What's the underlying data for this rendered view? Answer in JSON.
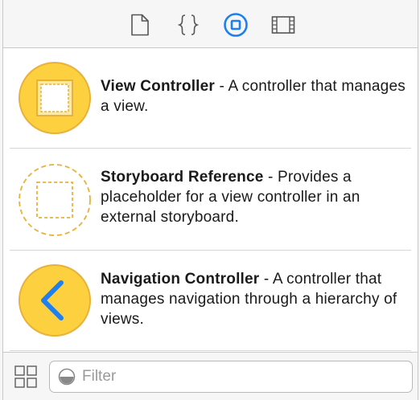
{
  "toolbar": {
    "tabs": [
      {
        "icon": "file-template-icon",
        "selected": false
      },
      {
        "icon": "code-snippet-icon",
        "selected": false
      },
      {
        "icon": "object-library-icon",
        "selected": true
      },
      {
        "icon": "media-library-icon",
        "selected": false
      }
    ],
    "accent_color": "#1e7ff0"
  },
  "library": {
    "items": [
      {
        "title": "View Controller",
        "separator": " - ",
        "description": "A controller that manages a view.",
        "icon": "view-controller-icon"
      },
      {
        "title": "Storyboard Reference",
        "separator": " - ",
        "description": "Provides a placeholder for a view controller in an external storyboard.",
        "icon": "storyboard-reference-icon"
      },
      {
        "title": "Navigation Controller",
        "separator": " - ",
        "description": "A controller that manages navigation through a hierarchy of views.",
        "icon": "navigation-controller-icon"
      }
    ],
    "icon_color": "#fcd03f",
    "icon_stroke": "#e8b23a"
  },
  "filter": {
    "placeholder": "Filter",
    "value": ""
  }
}
